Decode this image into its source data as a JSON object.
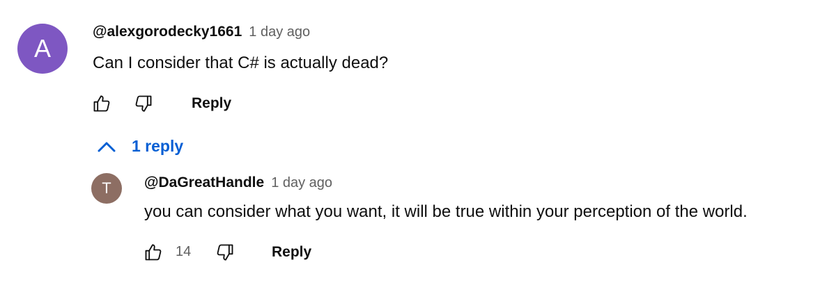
{
  "colors": {
    "avatar_main": "#7e57c2",
    "avatar_reply": "#8d6e63",
    "link_blue": "#065fd4",
    "meta_gray": "#606060",
    "text": "#0f0f0f"
  },
  "comment": {
    "avatar_letter": "A",
    "author": "@alexgorodecky1661",
    "time": "1 day ago",
    "text": "Can I consider that C# is actually dead?",
    "like_icon": "thumbs-up-icon",
    "dislike_icon": "thumbs-down-icon",
    "reply_label": "Reply"
  },
  "replies_toggle": {
    "icon": "chevron-up-icon",
    "label": "1 reply"
  },
  "reply": {
    "avatar_letter": "T",
    "author": "@DaGreatHandle",
    "time": "1 day ago",
    "text": "you can consider what you want, it will be true within your perception of the world.",
    "like_count": "14",
    "like_icon": "thumbs-up-icon",
    "dislike_icon": "thumbs-down-icon",
    "reply_label": "Reply"
  }
}
